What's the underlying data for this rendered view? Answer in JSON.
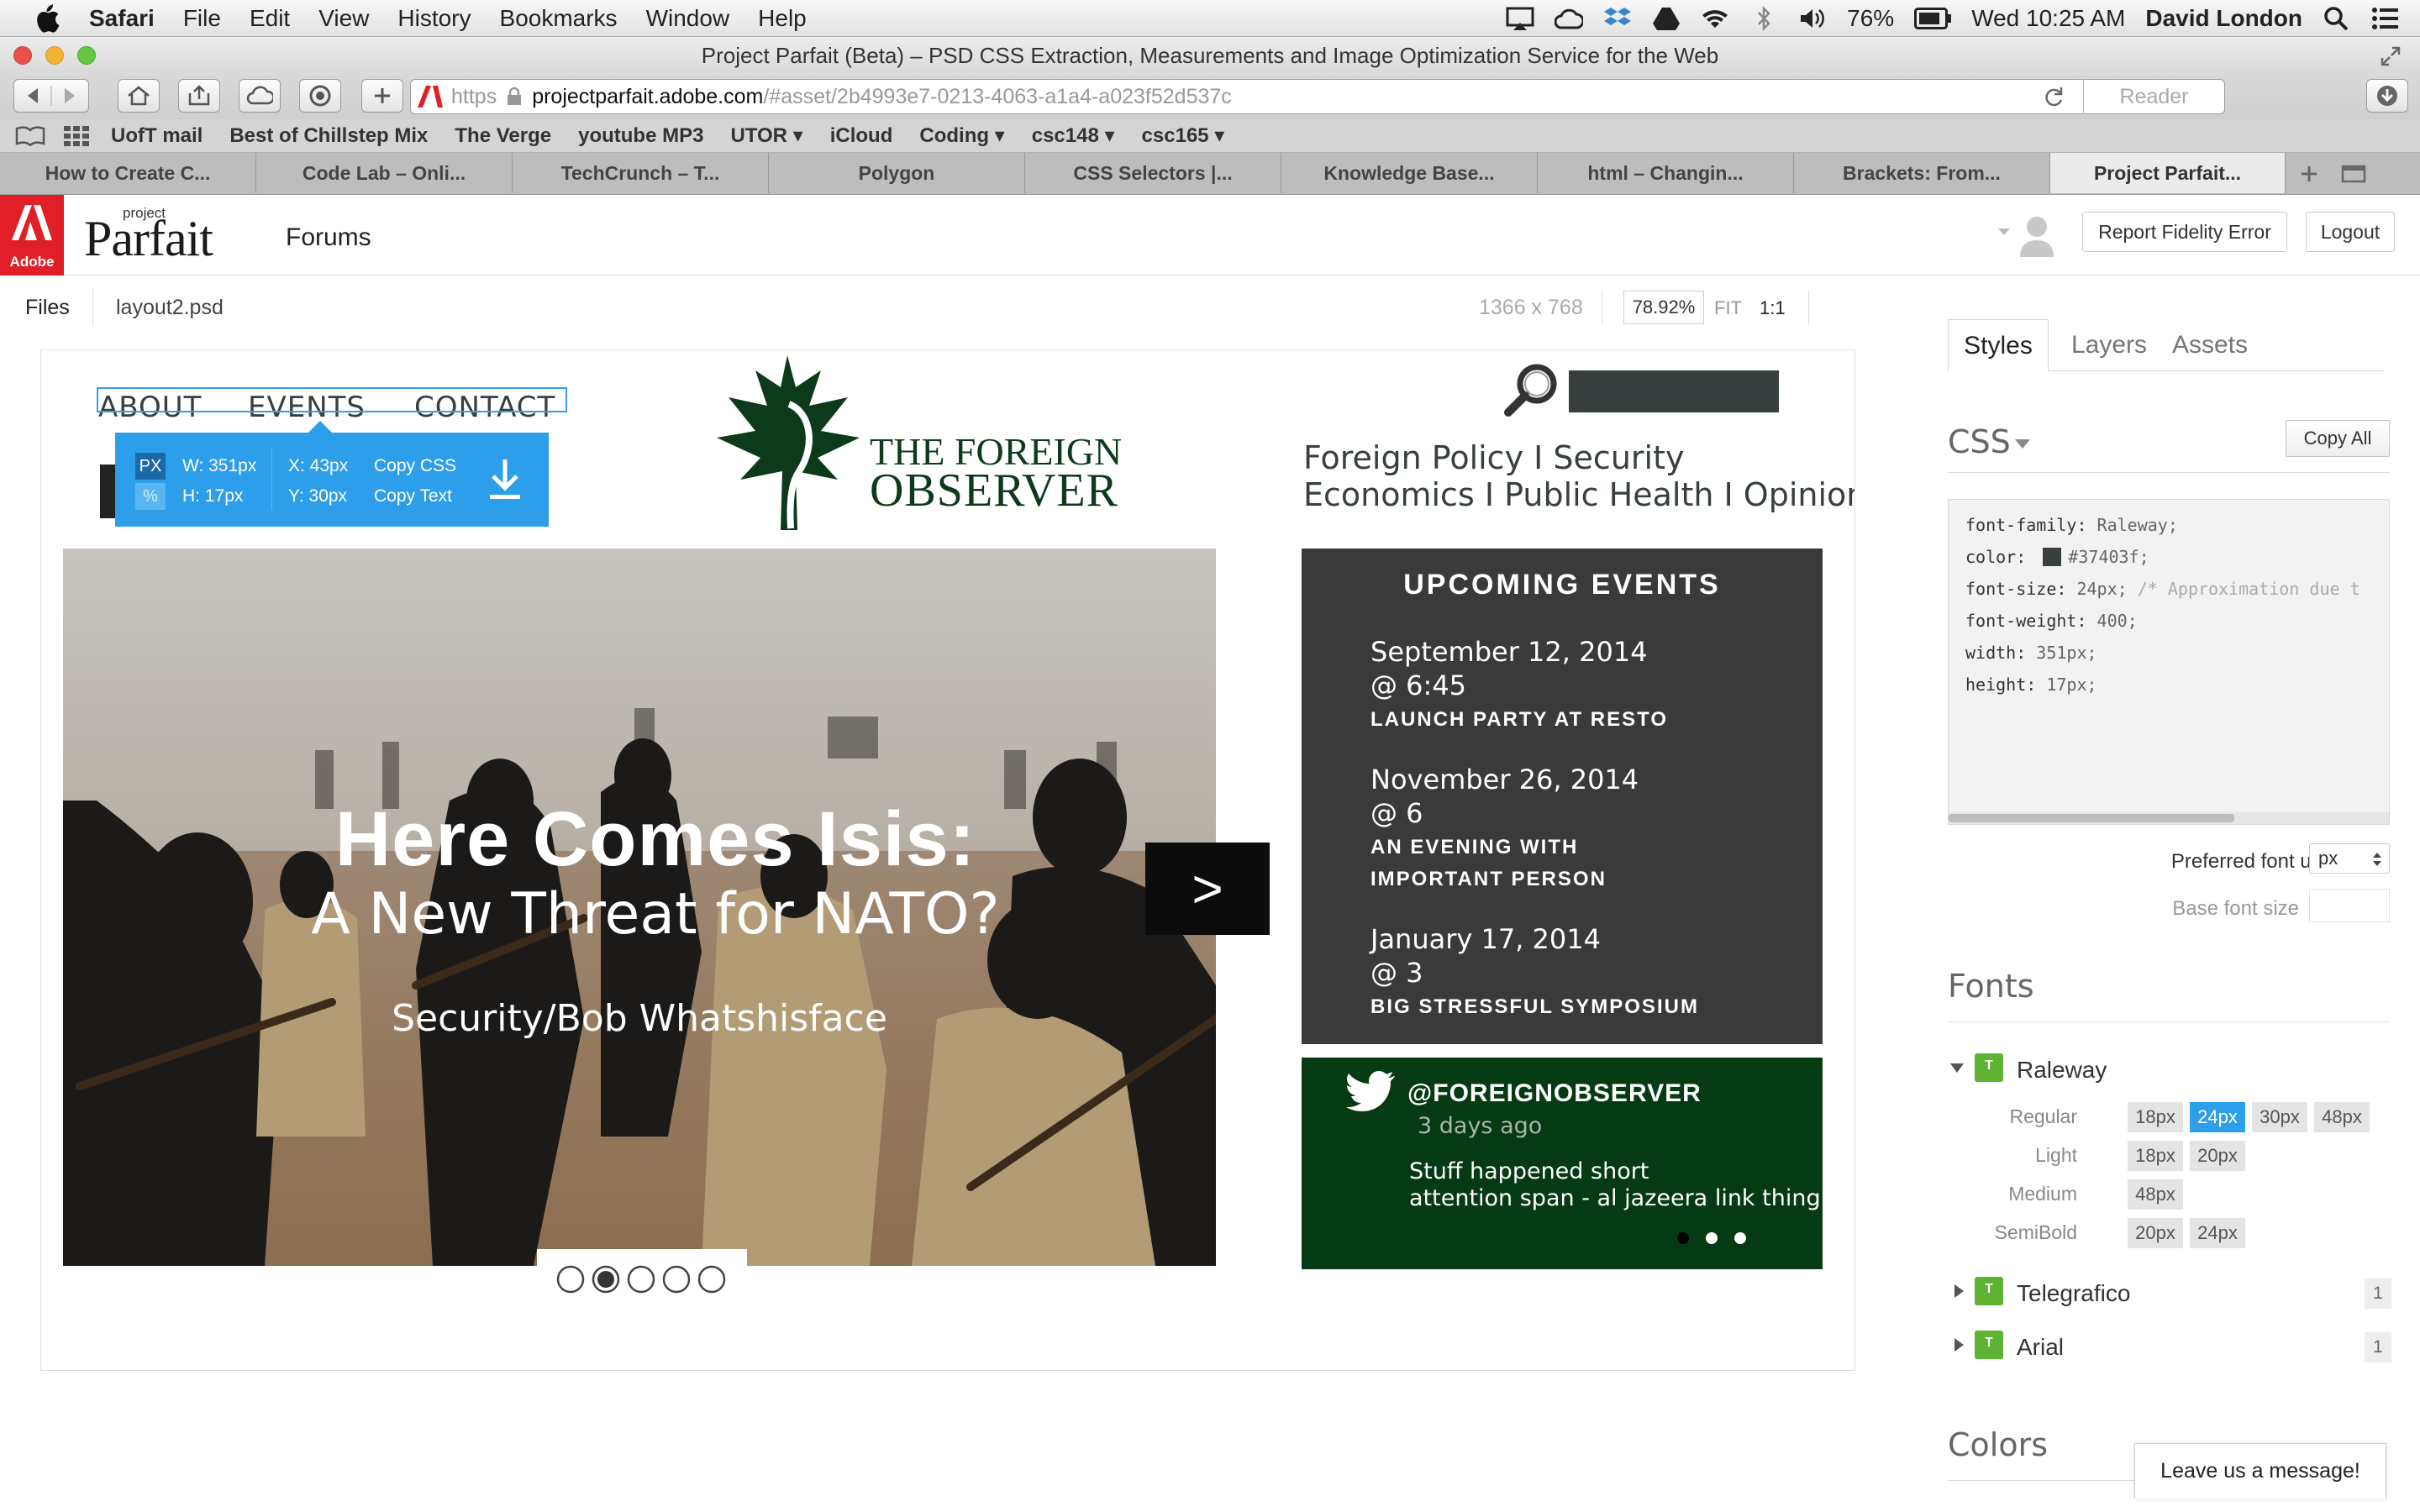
{
  "menubar": {
    "items": [
      "Safari",
      "File",
      "Edit",
      "View",
      "History",
      "Bookmarks",
      "Window",
      "Help"
    ],
    "battery": "76%",
    "clock": "Wed 10:25 AM",
    "user": "David London"
  },
  "window": {
    "title": "Project Parfait (Beta) – PSD CSS Extraction, Measurements and Image Optimization Service for the Web",
    "url_scheme": "https",
    "url_host": "projectparfait.adobe.com",
    "url_path": "/#asset/2b4993e7-0213-4063-a1a4-a023f52d537c",
    "reader_label": "Reader"
  },
  "bookmarks": [
    "UofT mail",
    "Best of Chillstep Mix",
    "The Verge",
    "youtube MP3",
    "UTOR ▾",
    "iCloud",
    "Coding ▾",
    "csc148 ▾",
    "csc165 ▾"
  ],
  "tabs": [
    "How to Create C...",
    "Code Lab – Onli...",
    "TechCrunch – T...",
    "Polygon",
    "CSS Selectors |...",
    "Knowledge Base...",
    "html – Changin...",
    "Brackets: From...",
    "Project Parfait..."
  ],
  "app": {
    "adobe_label": "Adobe",
    "logo_small": "project",
    "logo_big": "Parfait",
    "forums": "Forums",
    "report_btn": "Report Fidelity Error",
    "logout_btn": "Logout"
  },
  "filebar": {
    "files": "Files",
    "filename": "layout2.psd",
    "dimensions": "1366 x 768",
    "zoom": "78.92%",
    "fit": "FIT",
    "one_to_one": "1:1"
  },
  "canvas": {
    "nav": [
      "ABOUT",
      "EVENTS",
      "CONTACT"
    ],
    "tooltip": {
      "unit_px": "PX",
      "unit_pct": "%",
      "w": "W: 351px",
      "h": "H: 17px",
      "x": "X: 43px",
      "y": "Y: 30px",
      "copy_css": "Copy CSS",
      "copy_text": "Copy Text"
    },
    "brand_line1": "THE FOREIGN",
    "brand_line2": "OBSERVER",
    "tagline1": "Foreign Policy  I Security",
    "tagline2": "Economics I Public Health I Opinion",
    "hero_title": "Here Comes Isis:",
    "hero_subtitle": "A New Threat for NATO?",
    "hero_byline": "Security/Bob Whatshisface",
    "hero_next": ">",
    "events": {
      "heading": "UPCOMING EVENTS",
      "items": [
        {
          "date": "September 12, 2014",
          "time": "@ 6:45",
          "name": "LAUNCH PARTY AT RESTO"
        },
        {
          "date": "November 26, 2014",
          "time": "@ 6",
          "name": "AN EVENING WITH",
          "name2": "IMPORTANT PERSON"
        },
        {
          "date": "January 17, 2014",
          "time": "@ 3",
          "name": "BIG STRESSFUL SYMPOSIUM"
        }
      ]
    },
    "twitter": {
      "handle": "@FOREIGNOBSERVER",
      "ago": "3 days ago",
      "line1": "Stuff happened short",
      "line2": "attention span - al jazeera link thing"
    }
  },
  "panel": {
    "tabs": [
      "Styles",
      "Layers",
      "Assets"
    ],
    "css_label": "CSS",
    "copy_all": "Copy All",
    "css_lines": [
      {
        "prop": "font-family:",
        "val": "Raleway;"
      },
      {
        "prop": "color:",
        "val": "#37403f;",
        "swatch": "#37403f"
      },
      {
        "prop": "font-size:",
        "val": "24px;",
        "comment": "/* Approximation due t"
      },
      {
        "prop": "font-weight:",
        "val": "400;"
      },
      {
        "prop": "width:",
        "val": "351px;"
      },
      {
        "prop": "height:",
        "val": "17px;"
      }
    ],
    "pref_unit_label": "Preferred font unit",
    "pref_unit_value": "px",
    "base_size_label": "Base font size",
    "fonts_heading": "Fonts",
    "fonts": {
      "raleway": {
        "name": "Raleway",
        "rows": [
          {
            "weight": "Regular",
            "sizes": [
              "18px",
              "24px",
              "30px",
              "48px"
            ]
          },
          {
            "weight": "Light",
            "sizes": [
              "18px",
              "20px"
            ]
          },
          {
            "weight": "Medium",
            "sizes": [
              "48px"
            ]
          },
          {
            "weight": "SemiBold",
            "sizes": [
              "20px",
              "24px"
            ]
          }
        ]
      },
      "telegrafico": {
        "name": "Telegrafico",
        "count": "1"
      },
      "arial": {
        "name": "Arial",
        "count": "1"
      }
    },
    "colors_heading": "Colors",
    "chat": "Leave us a message!"
  }
}
